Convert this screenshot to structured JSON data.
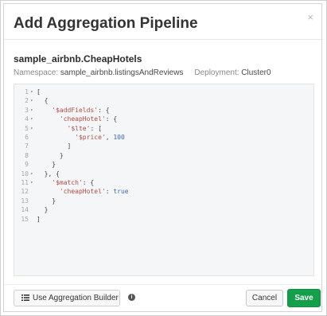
{
  "modal": {
    "title": "Add Aggregation Pipeline",
    "close_glyph": "×"
  },
  "pipeline": {
    "name": "sample_airbnb.CheapHotels",
    "namespace_label": "Namespace:",
    "namespace_value": "sample_airbnb.listingsAndReviews",
    "deployment_label": "Deployment:",
    "deployment_value": "Cluster0"
  },
  "editor": {
    "lines": [
      {
        "n": "1",
        "fold": "▾",
        "text": "["
      },
      {
        "n": "2",
        "fold": "▾",
        "text": "  {"
      },
      {
        "n": "3",
        "fold": "▾",
        "text": "    '$addFields': {"
      },
      {
        "n": "4",
        "fold": "▾",
        "text": "      'cheapHotel': {"
      },
      {
        "n": "5",
        "fold": "▾",
        "text": "        '$lte': ["
      },
      {
        "n": "6",
        "fold": "",
        "text": "          '$price', 100"
      },
      {
        "n": "7",
        "fold": "",
        "text": "        ]"
      },
      {
        "n": "8",
        "fold": "",
        "text": "      }"
      },
      {
        "n": "9",
        "fold": "",
        "text": "    }"
      },
      {
        "n": "10",
        "fold": "▾",
        "text": "  }, {"
      },
      {
        "n": "11",
        "fold": "▾",
        "text": "    '$match': {"
      },
      {
        "n": "12",
        "fold": "",
        "text": "      'cheapHotel': true"
      },
      {
        "n": "13",
        "fold": "",
        "text": "    }"
      },
      {
        "n": "14",
        "fold": "",
        "text": "  }"
      },
      {
        "n": "15",
        "fold": "",
        "text": "]"
      }
    ]
  },
  "footer": {
    "builder_label": "Use Aggregation Builder",
    "info_glyph": "i",
    "cancel_label": "Cancel",
    "save_label": "Save"
  },
  "icons": {
    "close": "close-icon",
    "list": "list-icon",
    "info": "info-icon",
    "fold": "fold-arrow-icon"
  },
  "colors": {
    "save_bg": "#14a04a",
    "editor_bg": "#f5f6f7",
    "string": "#b04a47",
    "number": "#3f68b3"
  }
}
